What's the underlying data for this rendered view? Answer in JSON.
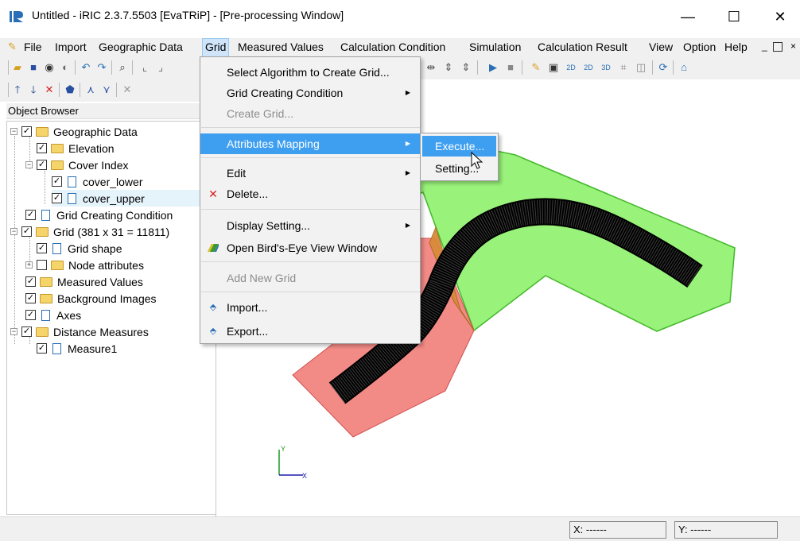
{
  "window": {
    "title": "Untitled - iRIC 2.3.7.5503 [EvaTRiP] - [Pre-processing Window]",
    "minimize": "—",
    "maximize": "☐",
    "close": "✕"
  },
  "menubar": {
    "file": "File",
    "import": "Import",
    "geographic_data": "Geographic Data",
    "grid": "Grid",
    "measured_values": "Measured Values",
    "calculation_condition": "Calculation Condition",
    "simulation": "Simulation",
    "calculation_result": "Calculation Result",
    "view": "View",
    "option": "Option",
    "help": "Help"
  },
  "object_browser": {
    "header": "Object Browser",
    "items": [
      {
        "label": "Geographic Data",
        "checked": true
      },
      {
        "label": "Elevation",
        "checked": true
      },
      {
        "label": "Cover Index",
        "checked": true
      },
      {
        "label": "cover_lower",
        "checked": true
      },
      {
        "label": "cover_upper",
        "checked": true
      },
      {
        "label": "Grid Creating Condition",
        "checked": true
      },
      {
        "label": "Grid (381 x 31 = 11811)",
        "checked": true
      },
      {
        "label": "Grid shape",
        "checked": true
      },
      {
        "label": "Node attributes",
        "checked": false
      },
      {
        "label": "Measured Values",
        "checked": true
      },
      {
        "label": "Background Images",
        "checked": true
      },
      {
        "label": "Axes",
        "checked": true
      },
      {
        "label": "Distance Measures",
        "checked": true
      },
      {
        "label": "Measure1",
        "checked": true
      }
    ]
  },
  "grid_menu": {
    "select_algorithm": "Select Algorithm to Create Grid...",
    "grid_creating_condition": "Grid Creating Condition",
    "create_grid": "Create Grid...",
    "attributes_mapping": "Attributes Mapping",
    "edit": "Edit",
    "delete": "Delete...",
    "display_setting": "Display Setting...",
    "open_birds_eye": "Open Bird's-Eye View Window",
    "add_new_grid": "Add New Grid",
    "import": "Import...",
    "export": "Export..."
  },
  "submenu": {
    "execute": "Execute...",
    "setting": "Setting..."
  },
  "axes": {
    "y": "Y",
    "x": "X"
  },
  "status": {
    "x": "X: ------",
    "y": "Y: ------"
  },
  "colors": {
    "menu_highlight": "#3e9ff0",
    "green_polygon": "#99f27a",
    "red_polygon": "#f28a86",
    "orange_polygon": "#d88a3a",
    "grid_black": "#000000"
  }
}
